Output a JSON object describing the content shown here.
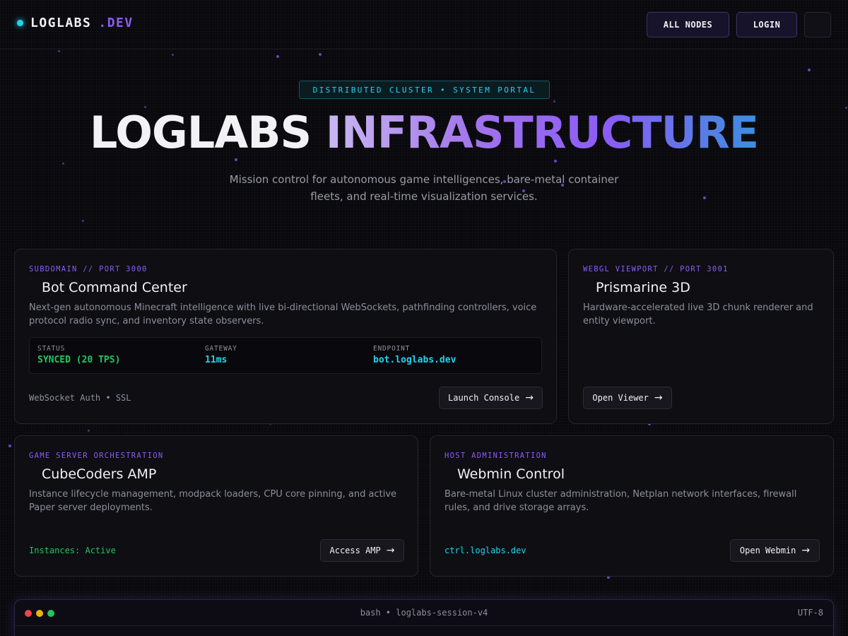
{
  "header": {
    "brand_name": "LOGLABS",
    "brand_tld": ".DEV",
    "all_nodes_label": "ALL NODES",
    "login_label": "LOGIN"
  },
  "hero": {
    "tag": "DISTRIBUTED CLUSTER • SYSTEM PORTAL",
    "title_part1": "LOGLABS",
    "title_part2": "INFRASTRUCTURE",
    "subtitle": "Mission control for autonomous game intelligences, bare-metal container fleets, and real-time visualization services."
  },
  "cards": {
    "bot": {
      "kicker": "SUBDOMAIN // PORT 3000",
      "title": "Bot Command Center",
      "desc": "Next-gen autonomous Minecraft intelligence with live bi-directional WebSockets, pathfinding controllers, voice protocol radio sync, and inventory state observers.",
      "stats": [
        {
          "label": "STATUS",
          "value": "SYNCED (20 TPS)"
        },
        {
          "label": "GATEWAY",
          "value": "11ms"
        },
        {
          "label": "ENDPOINT",
          "value": "bot.loglabs.dev"
        }
      ],
      "footer": "WebSocket Auth • SSL",
      "action": "Launch Console"
    },
    "prismarine": {
      "kicker": "WEBGL VIEWPORT // PORT 3001",
      "title": "Prismarine 3D",
      "desc": "Hardware-accelerated live 3D chunk renderer and entity viewport.",
      "action": "Open Viewer"
    },
    "amp": {
      "kicker": "GAME SERVER ORCHESTRATION",
      "title": "CubeCoders AMP",
      "desc": "Instance lifecycle management, modpack loaders, CPU core pinning, and active Paper server deployments.",
      "footer": "Instances: Active",
      "action": "Access AMP"
    },
    "webmin": {
      "kicker": "HOST ADMINISTRATION",
      "title": "Webmin Control",
      "desc": "Bare-metal Linux cluster administration, Netplan network interfaces, firewall rules, and drive storage arrays.",
      "footer": "ctrl.loglabs.dev",
      "action": "Open Webmin"
    }
  },
  "terminal": {
    "title": "bash • loglabs-session-v4",
    "encoding": "UTF-8"
  },
  "colors": {
    "accent_purple": "#8b5cf6",
    "accent_cyan": "#22d3ee",
    "status_green": "#22c55e",
    "background": "#09090d"
  },
  "icons": [
    "status-dot-icon",
    "menu-icon",
    "arrow-right-icon"
  ]
}
